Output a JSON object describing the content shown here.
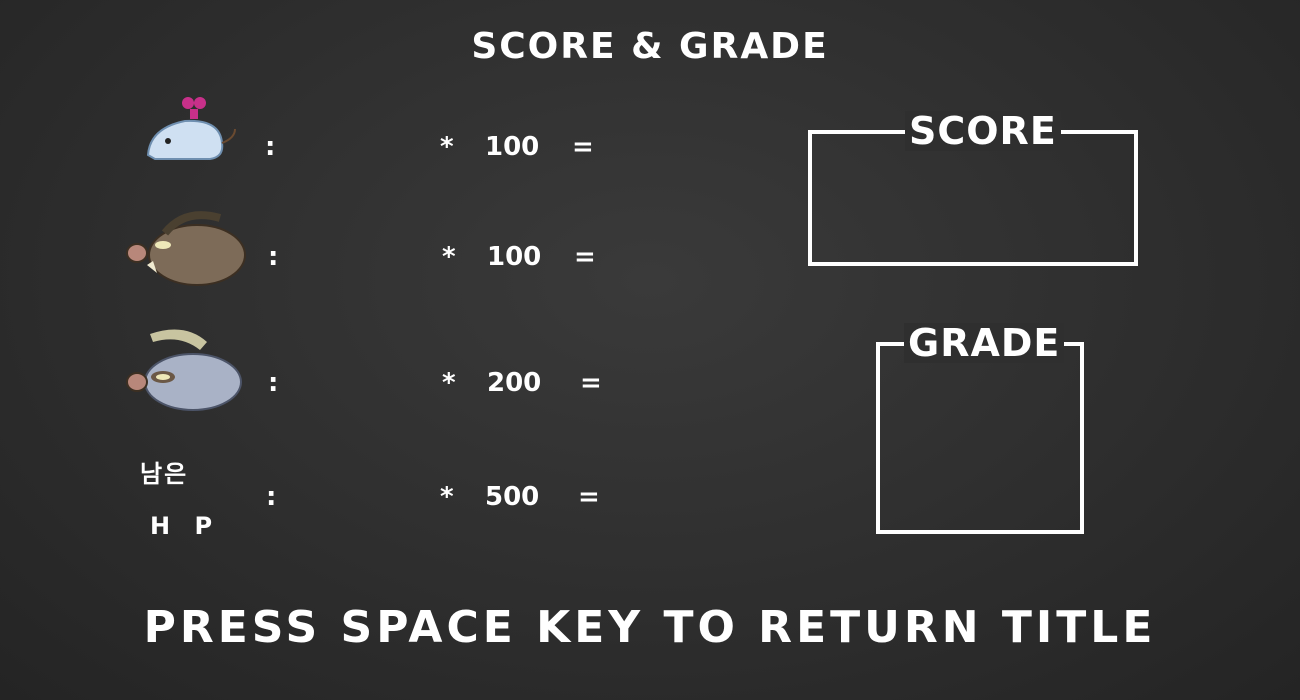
{
  "title": "SCORE & GRADE",
  "rows": [
    {
      "enemy": "wind-up mouse",
      "colon": ":",
      "mul": "*",
      "points": "100",
      "eq": "="
    },
    {
      "enemy": "wild boar",
      "colon": ":",
      "mul": "*",
      "points": "100",
      "eq": "="
    },
    {
      "enemy": "armored boar",
      "colon": ":",
      "mul": "*",
      "points": "200",
      "eq": "="
    },
    {
      "label_top": "남은",
      "label_bottom": "H P",
      "colon": ":",
      "mul": "*",
      "points": "500",
      "eq": "="
    }
  ],
  "score_box": {
    "label": "SCORE"
  },
  "grade_box": {
    "label": "GRADE"
  },
  "footer": "PRESS SPACE KEY TO RETURN TITLE"
}
